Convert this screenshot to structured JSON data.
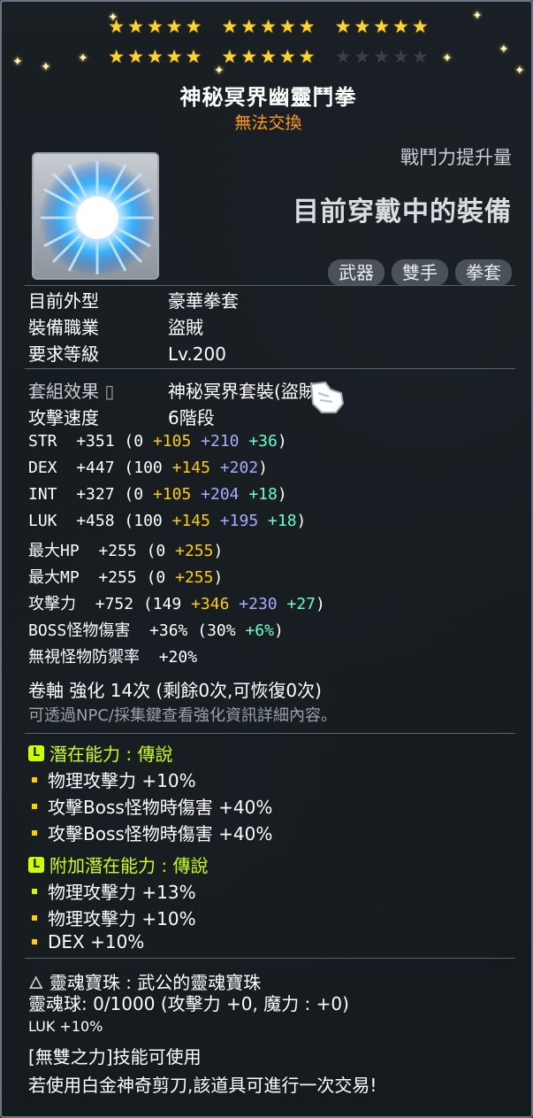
{
  "stars": {
    "filled_first_row": 15,
    "filled_second_row": 10,
    "total_second_row": 15
  },
  "item": {
    "name": "神秘冥界幽靈鬥拳",
    "trade_note": "無法交換",
    "power_label": "戰鬥力提升量",
    "equipped_label": "目前穿戴中的裝備",
    "tags": [
      "武器",
      "雙手",
      "拳套"
    ]
  },
  "info": [
    {
      "label": "目前外型",
      "value": "豪華拳套"
    },
    {
      "label": "裝備職業",
      "value": "盜賊"
    },
    {
      "label": "要求等級",
      "value": "Lv.200"
    }
  ],
  "set": {
    "label": "套組效果",
    "value": "神秘冥界套裝(盜賊)"
  },
  "speed": {
    "label": "攻擊速度",
    "value": "6階段"
  },
  "stats": [
    {
      "name": "STR",
      "total": "+351",
      "base": "(0",
      "add1": "+105",
      "add2": "+210",
      "add3": "+36",
      "end": ")"
    },
    {
      "name": "DEX",
      "total": "+447",
      "base": "(100",
      "add1": "+145",
      "add2": "+202",
      "add3": "",
      "end": ")"
    },
    {
      "name": "INT",
      "total": "+327",
      "base": "(0",
      "add1": "+105",
      "add2": "+204",
      "add3": "+18",
      "end": ")"
    },
    {
      "name": "LUK",
      "total": "+458",
      "base": "(100",
      "add1": "+145",
      "add2": "+195",
      "add3": "+18",
      "end": ")"
    },
    {
      "name": "最大HP",
      "total": "+255",
      "base": "(0",
      "add1": "+255",
      "add2": "",
      "add3": "",
      "end": ")"
    },
    {
      "name": "最大MP",
      "total": "+255",
      "base": "(0",
      "add1": "+255",
      "add2": "",
      "add3": "",
      "end": ")"
    },
    {
      "name": "攻擊力",
      "total": "+752",
      "base": "(149",
      "add1": "+346",
      "add2": "+230",
      "add3": "+27",
      "end": ")"
    }
  ],
  "boss": {
    "name": "BOSS怪物傷害",
    "total": "+36%",
    "base": "(30%",
    "add": "+6%",
    "end": ")"
  },
  "ignore_def": {
    "name": "無視怪物防禦率",
    "total": "+20%"
  },
  "scroll": {
    "text": "卷軸 強化 14次 (剩餘0次,可恢復0次)",
    "hint": "可透過NPC/採集鍵查看強化資訊詳細內容。"
  },
  "potential": {
    "header": "潛在能力 : 傳說",
    "badge": "L",
    "lines": [
      "物理攻擊力 +10%",
      "攻擊Boss怪物時傷害 +40%",
      "攻擊Boss怪物時傷害 +40%"
    ]
  },
  "bonus_potential": {
    "header": "附加潛在能力 : 傳說",
    "badge": "L",
    "lines": [
      "物理攻擊力 +13%",
      "物理攻擊力 +10%",
      "DEX +10%"
    ]
  },
  "soul": {
    "header": "靈魂寶珠 : 武公的靈魂寶珠",
    "orb": "靈魂球: 0/1000 (攻擊力 +0, 魔力 : +0)",
    "extra": "LUK +10%",
    "skill": "[無雙之力]技能可使用",
    "notice": "若使用白金神奇剪刀,該道具可進行一次交易!"
  },
  "colors": {
    "gold": "#ffcc00",
    "purple": "#aaaaff",
    "green": "#66ffcc",
    "lime": "#ccff00",
    "orange": "#ff9a16"
  }
}
